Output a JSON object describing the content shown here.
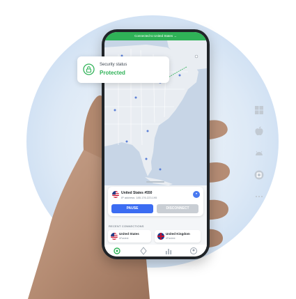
{
  "colors": {
    "accent_green": "#2fb257",
    "primary_blue": "#3b6cf2",
    "disabled_gray": "#c9ced4",
    "land": "#e9edf2",
    "water": "#c7d5e6",
    "platform_icon": "#c2cad3"
  },
  "status_bar": {
    "text": "Connected to United States →"
  },
  "security_card": {
    "title": "Security status",
    "status": "Protected",
    "icon": "lock-icon"
  },
  "connection": {
    "server": "United States #550",
    "ip_label": "IP address:",
    "ip_value": "185.176.223.195",
    "pause_label": "PAUSE",
    "disconnect_label": "DISCONNECT"
  },
  "recent": {
    "label": "RECENT CONNECTIONS",
    "items": [
      {
        "name": "United States",
        "sub": "#Fastest"
      },
      {
        "name": "United Kingdom",
        "sub": "#Fastest"
      }
    ]
  },
  "tabs": [
    "vpn-icon",
    "meshnet-icon",
    "stats-icon",
    "profile-icon"
  ],
  "platforms": [
    "windows-icon",
    "apple-icon",
    "android-icon",
    "browser-extension-icon",
    "more-icon"
  ]
}
